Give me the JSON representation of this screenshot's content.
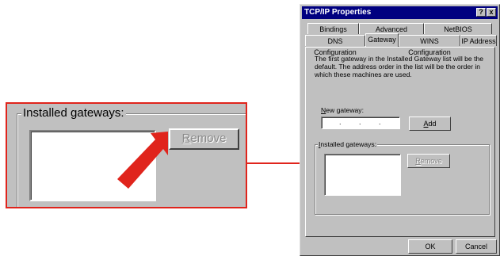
{
  "zoom": {
    "group_label": "Installed gateways:",
    "remove_label_u": "R",
    "remove_label_rest": "emove"
  },
  "dialog": {
    "title": "TCP/IP Properties",
    "help_glyph": "?",
    "close_glyph": "x",
    "tabs_back": [
      "Bindings",
      "Advanced",
      "NetBIOS"
    ],
    "tabs_front": [
      "DNS Configuration",
      "Gateway",
      "WINS Configuration",
      "IP Address"
    ],
    "active_tab": "Gateway",
    "description": "The first gateway in the Installed Gateway list will be the default. The address order in the list will be the order in which these machines are used.",
    "new_gateway_u": "N",
    "new_gateway_rest": "ew gateway:",
    "ip_dots": [
      ".",
      ".",
      "."
    ],
    "add_u": "A",
    "add_rest": "dd",
    "installed_label_u": "I",
    "installed_label_rest": "nstalled gateways:",
    "remove_u": "R",
    "remove_rest": "emove",
    "ok_label": "OK",
    "cancel_label": "Cancel"
  },
  "colors": {
    "highlight_red": "#e0241c",
    "title_blue": "#000080",
    "face_gray": "#c0c0c0"
  }
}
